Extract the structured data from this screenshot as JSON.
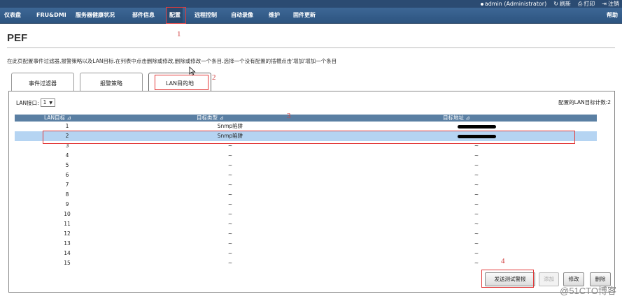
{
  "topbar": {
    "user": "admin (Administrator)",
    "refresh": "刷新",
    "print": "打印",
    "logout": "注销"
  },
  "nav": {
    "items": [
      "仪表盘",
      "FRU&DMI",
      "服务器健康状况",
      "部件信息",
      "配置",
      "远程控制",
      "自动录像",
      "维护",
      "固件更新"
    ],
    "active": "配置",
    "help": "帮助"
  },
  "page": {
    "title": "PEF",
    "description": "在此页配置事件过滤器,报警策略以及LAN目标.在列表中点击删除或修改,删除或修改一个条目.选择一个没有配置的插槽点击'增加'增加一个条目"
  },
  "tabs": [
    {
      "label": "事件过滤器"
    },
    {
      "label": "报警策略"
    },
    {
      "label": "LAN目的地"
    }
  ],
  "lan": {
    "label": "LAN接口:",
    "selected": "1",
    "count_label": "配置的LAN目标计数:2"
  },
  "table": {
    "headers": [
      "LAN目标 ⊿",
      "目标类型 ⊿",
      "目标地址 ⊿"
    ],
    "rows": [
      [
        "1",
        "Snmp陷阱",
        "[redacted]"
      ],
      [
        "2",
        "Snmp陷阱",
        "[redacted]"
      ],
      [
        "3",
        "~",
        "~"
      ],
      [
        "4",
        "~",
        "~"
      ],
      [
        "5",
        "~",
        "~"
      ],
      [
        "6",
        "~",
        "~"
      ],
      [
        "7",
        "~",
        "~"
      ],
      [
        "8",
        "~",
        "~"
      ],
      [
        "9",
        "~",
        "~"
      ],
      [
        "10",
        "~",
        "~"
      ],
      [
        "11",
        "~",
        "~"
      ],
      [
        "12",
        "~",
        "~"
      ],
      [
        "13",
        "~",
        "~"
      ],
      [
        "14",
        "~",
        "~"
      ],
      [
        "15",
        "~",
        "~"
      ]
    ],
    "selected_row": 2
  },
  "buttons": {
    "send_test": "发送测试警报",
    "add": "添加",
    "modify": "修改",
    "delete": "删除"
  },
  "annotations": [
    "1",
    "2",
    "3",
    "4"
  ],
  "watermark": "@51CTO博客",
  "colors": {
    "nav": "#2d5480",
    "header_row": "#5a7fa3",
    "selected_row": "#b5d4f2",
    "annotation": "#e23a3a"
  }
}
